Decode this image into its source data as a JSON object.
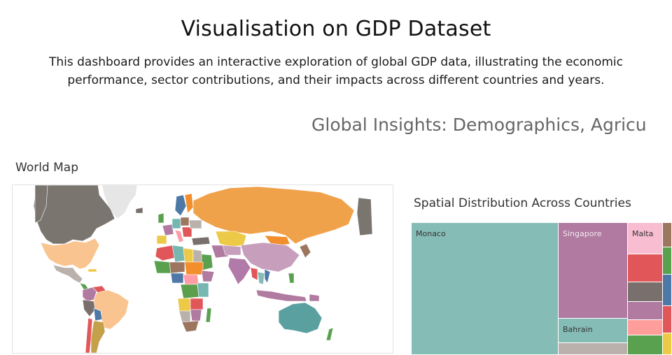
{
  "page": {
    "title": "Visualisation on GDP Dataset",
    "description": "This dashboard provides an interactive exploration of global GDP data, illustrating the economic performance, sector contributions, and their impacts across different countries and years.",
    "insights_heading": "Global Insights: Demographics, Agricu"
  },
  "world_map": {
    "title": "World Map",
    "colors": {
      "russia": "#f0a24b",
      "north_america": "#7b7570",
      "usa": "#f9c48f",
      "greenland": "#e6e6e6",
      "south_america_brazil": "#f9c48f",
      "argentina": "#c4a04a",
      "china": "#c79fbd",
      "india": "#b17aa8",
      "australia": "#5aa0a0",
      "africa_mix": [
        "#5b9e4b",
        "#e15759",
        "#76b7b2",
        "#edc948",
        "#b07aa1",
        "#ff9da7",
        "#9c755f",
        "#bab0ac",
        "#4e79a7",
        "#f28e2b"
      ]
    }
  },
  "treemap": {
    "title": "Spatial Distribution Across Countries",
    "tiles": [
      {
        "label": "Monaco",
        "color": "#86bcb6"
      },
      {
        "label": "Singapore",
        "color": "#b07aa1"
      },
      {
        "label": "Malta",
        "color": "#f8bdd0"
      },
      {
        "label": "Bahrain",
        "color": "#86bcb6"
      },
      {
        "label": "",
        "color": "#e15759"
      },
      {
        "label": "",
        "color": "#79706e"
      },
      {
        "label": "",
        "color": "#b07aa1"
      },
      {
        "label": "",
        "color": "#ff9d9a"
      },
      {
        "label": "",
        "color": "#59a14f"
      },
      {
        "label": "",
        "color": "#bab0ac"
      },
      {
        "label": "",
        "color": "#9d7660"
      },
      {
        "label": "",
        "color": "#59a14f"
      },
      {
        "label": "",
        "color": "#4e79a7"
      },
      {
        "label": "",
        "color": "#e15759"
      },
      {
        "label": "",
        "color": "#edc948"
      }
    ]
  }
}
